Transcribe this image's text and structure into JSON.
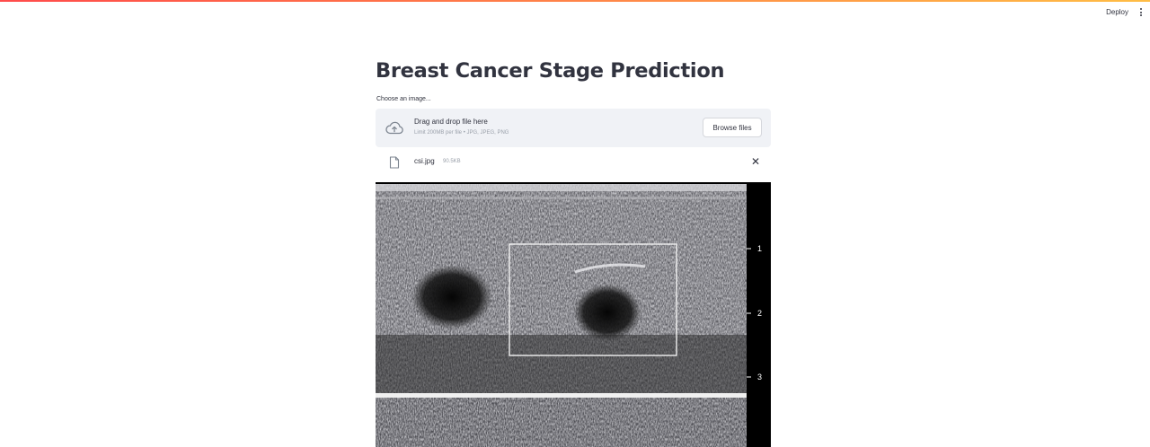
{
  "header": {
    "deploy_label": "Deploy"
  },
  "main": {
    "title": "Breast Cancer Stage Prediction",
    "uploader": {
      "label": "Choose an image...",
      "drop_text": "Drag and drop file here",
      "limit_text": "Limit 200MB per file • JPG, JPEG, PNG",
      "browse_label": "Browse files"
    },
    "file": {
      "name": "csi.jpg",
      "size": "90.5KB"
    },
    "image": {
      "depth_marks": [
        "1",
        "2",
        "3"
      ]
    }
  },
  "colors": {
    "accent_start": "#ff4b4b",
    "accent_end": "#ffbd45",
    "dropzone_bg": "#f0f2f6",
    "text": "#31333f"
  },
  "icons": {
    "upload": "cloud-upload-icon",
    "file": "file-icon",
    "close": "close-icon",
    "menu": "more-vertical-icon"
  }
}
